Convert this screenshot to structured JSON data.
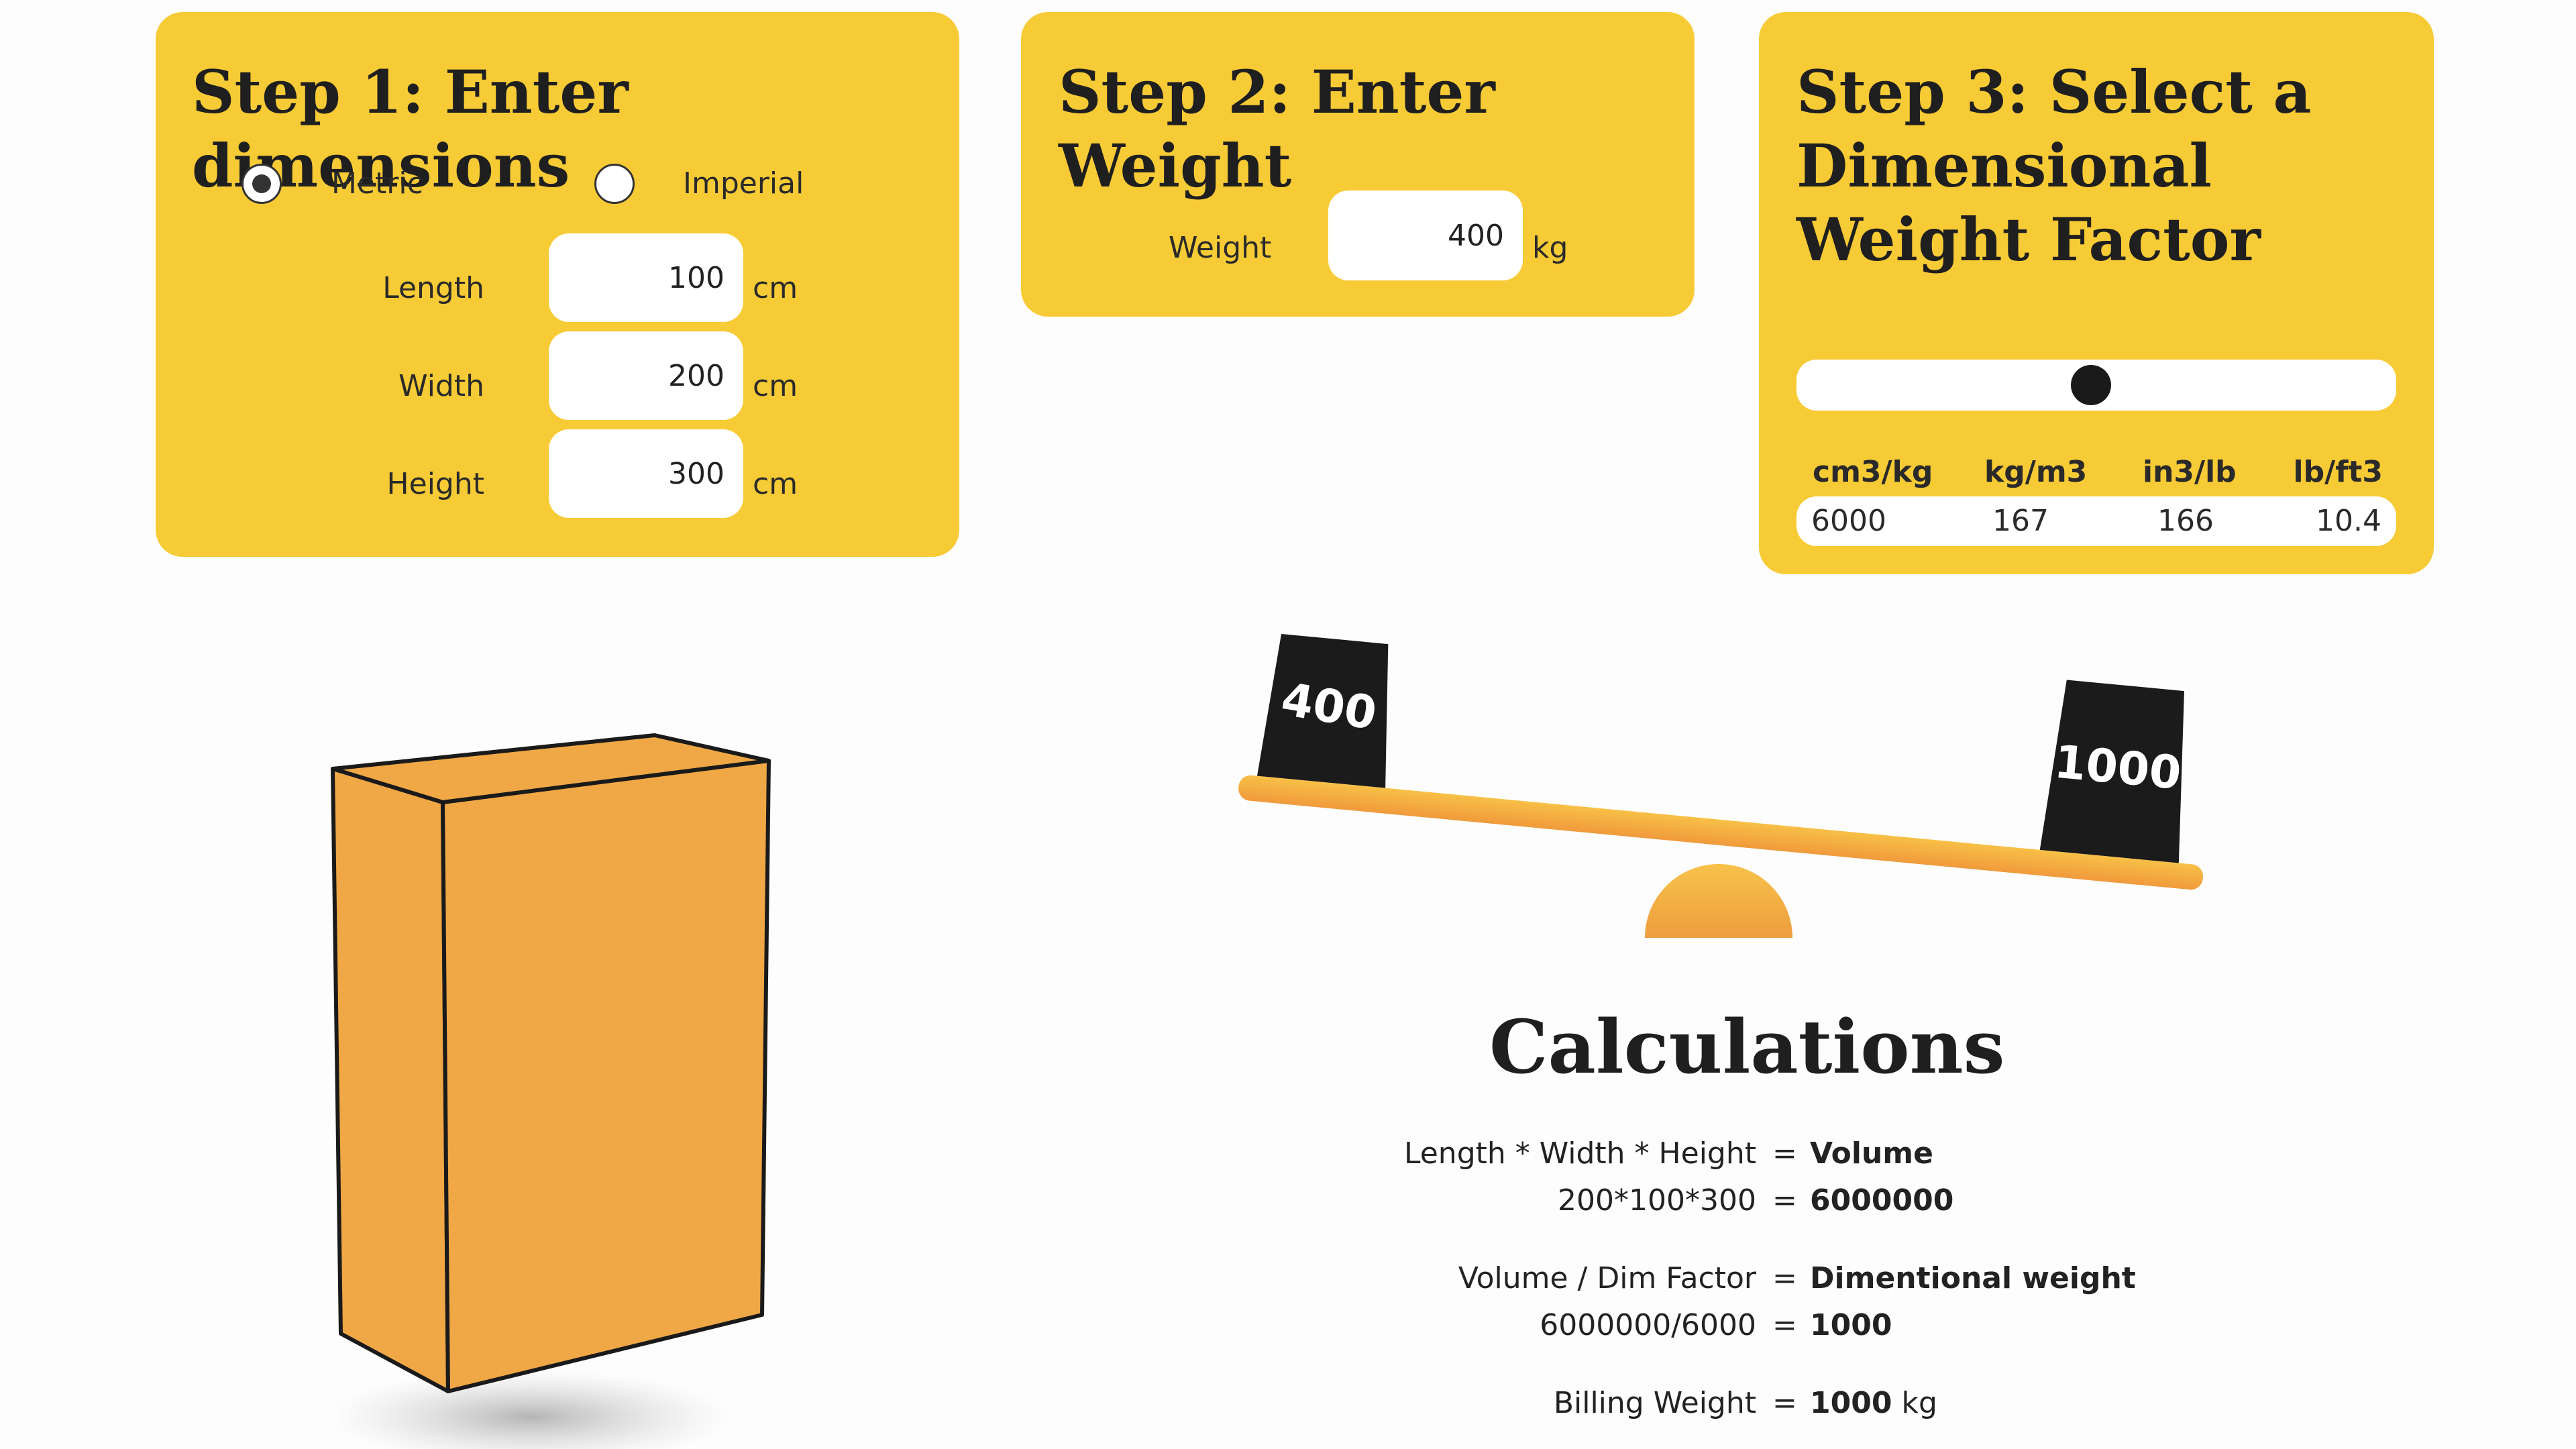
{
  "step1": {
    "title": "Step 1: Enter dimensions",
    "units": [
      {
        "label": "Metric",
        "selected": true
      },
      {
        "label": "Imperial",
        "selected": false
      }
    ],
    "fields": [
      {
        "label": "Length",
        "value": "100",
        "unit": "cm"
      },
      {
        "label": "Width",
        "value": "200",
        "unit": "cm"
      },
      {
        "label": "Height",
        "value": "300",
        "unit": "cm"
      }
    ]
  },
  "step2": {
    "title": "Step 2: Enter Weight",
    "label": "Weight",
    "value": "400",
    "unit": "kg"
  },
  "step3": {
    "title": "Step 3: Select a Dimensional Weight Factor",
    "slider_position": 0.49,
    "headers": [
      "cm3/kg",
      "kg/m3",
      "in3/lb",
      "lb/ft3"
    ],
    "values": [
      "6000",
      "167",
      "166",
      "10.4"
    ]
  },
  "scale": {
    "left_weight": "400",
    "right_weight": "1000"
  },
  "calculations": {
    "title": "Calculations",
    "equals": "=",
    "rows": [
      {
        "left": "Length * Width * Height",
        "right": "Volume",
        "unit": ""
      },
      {
        "left": "200*100*300",
        "right": "6000000",
        "unit": ""
      },
      {
        "left": "Volume / Dim Factor",
        "right": "Dimentional weight",
        "unit": ""
      },
      {
        "left": "6000000/6000",
        "right": "1000",
        "unit": ""
      },
      {
        "left": "Billing Weight",
        "right": "1000",
        "unit": "kg"
      }
    ]
  },
  "colors": {
    "card": "#f7cb35",
    "box": "#f0a745",
    "scale_bar": "#f5b13e",
    "weight": "#1b1b1b"
  }
}
